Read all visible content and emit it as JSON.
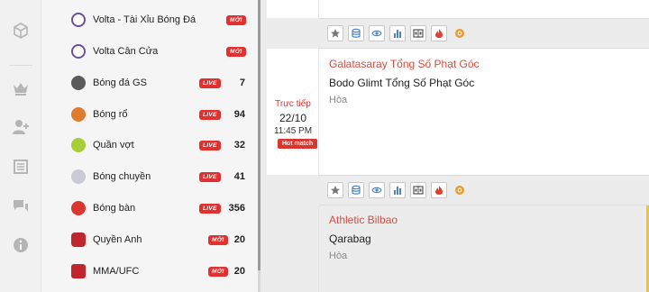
{
  "sidebar_icons": [
    "cube-icon",
    "crown-icon",
    "add-user-icon",
    "newspaper-icon",
    "chat-icon",
    "info-icon"
  ],
  "sports": [
    {
      "name": "Volta - Tài Xỉu Bóng Đá",
      "badge": "MỚI",
      "count": "",
      "icon_color": "#6b4fa0"
    },
    {
      "name": "Volta Cân Cửa",
      "badge": "MỚI",
      "count": "",
      "icon_color": "#6b4fa0"
    },
    {
      "name": "Bóng đá GS",
      "badge": "LIVE",
      "count": "7",
      "icon_color": "#5a5a5a"
    },
    {
      "name": "Bóng rổ",
      "badge": "LIVE",
      "count": "94",
      "icon_color": "#e07a2c"
    },
    {
      "name": "Quần vợt",
      "badge": "LIVE",
      "count": "32",
      "icon_color": "#a6cf36"
    },
    {
      "name": "Bóng chuyền",
      "badge": "LIVE",
      "count": "41",
      "icon_color": "#c9c9d8"
    },
    {
      "name": "Bóng bàn",
      "badge": "LIVE",
      "count": "356",
      "icon_color": "#d9362f"
    },
    {
      "name": "Quyền Anh",
      "badge": "MỚI",
      "count": "20",
      "icon_color": "#c0272d"
    },
    {
      "name": "MMA/UFC",
      "badge": "MỚI",
      "count": "20",
      "icon_color": "#c0272d"
    }
  ],
  "matches": [
    {
      "status": "Trực tiếp",
      "date": "22/10",
      "time": "11:45 PM",
      "tag": "Hot match",
      "home": "Galatasaray Tổng Số Phạt Góc",
      "away": "Bodo Glimt Tổng Số Phạt Góc",
      "result": "Hòa"
    },
    {
      "home": "Athletic Bilbao",
      "away": "Qarabag",
      "result": "Hòa"
    }
  ],
  "toolbar_icons": [
    "star-icon",
    "database-icon",
    "eye-icon",
    "bar-chart-icon",
    "scoreboard-icon",
    "fire-icon",
    "medal-icon"
  ],
  "colors": {
    "live_red": "#d9362f",
    "home_team": "#d44c3f",
    "accent_yellow": "#f2c230"
  }
}
